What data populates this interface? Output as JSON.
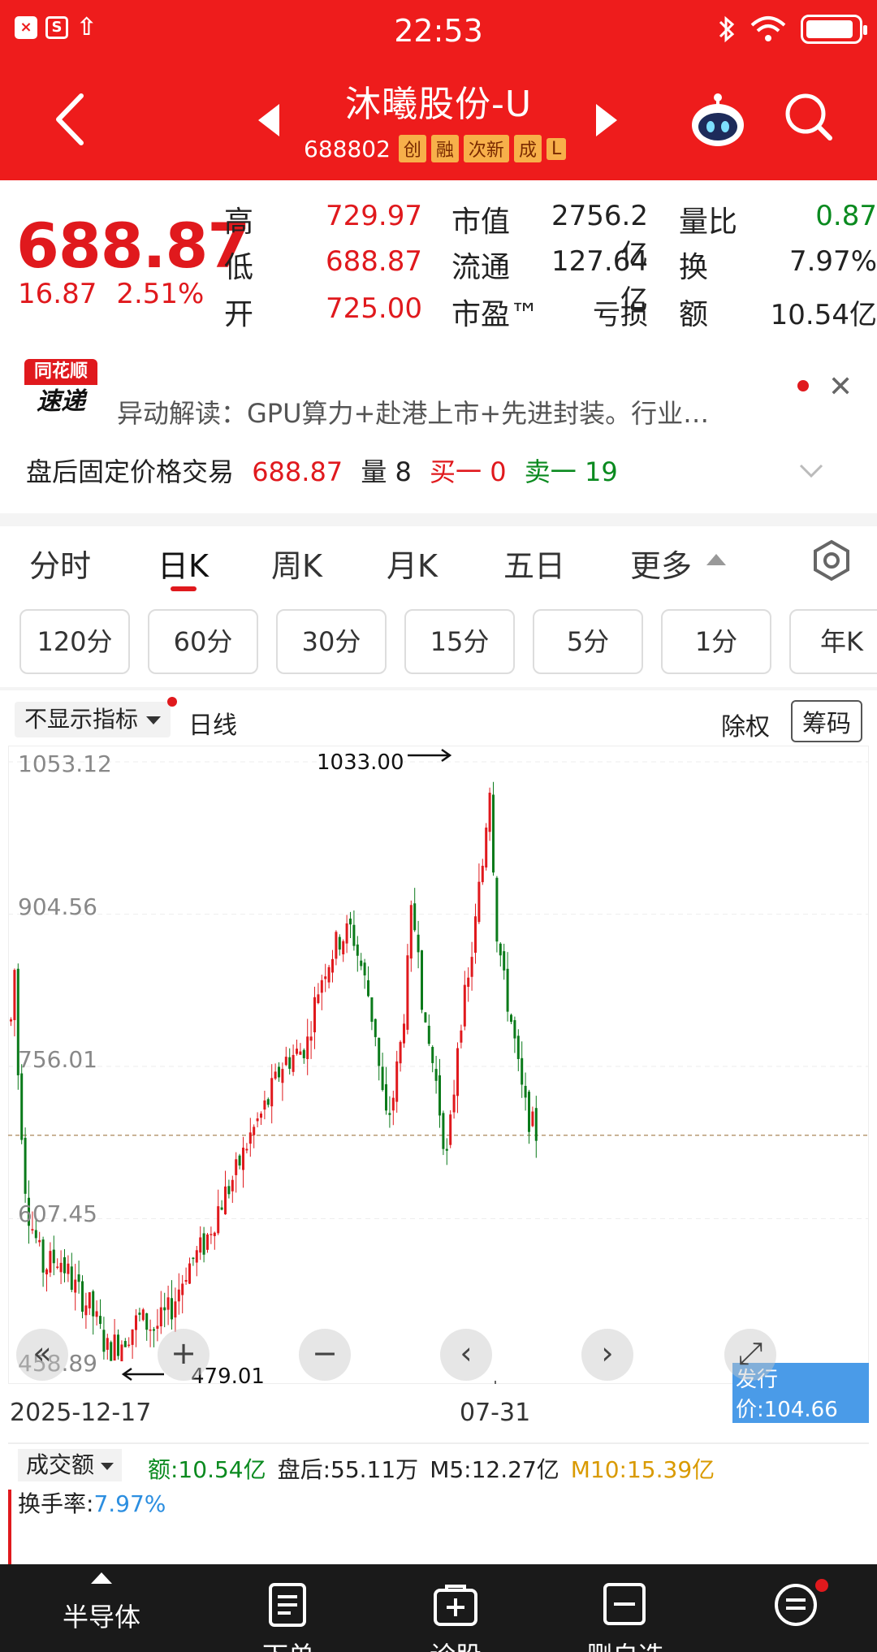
{
  "status_bar": {
    "time": "22:53"
  },
  "header": {
    "title": "沐曦股份-U",
    "code": "688802",
    "tags": [
      "创",
      "融",
      "次新",
      "成",
      "L"
    ]
  },
  "quote": {
    "price": "688.87",
    "change": "16.87",
    "change_pct": "2.51%",
    "fields": [
      {
        "label": "高",
        "value": "729.97",
        "color": "#e0191d"
      },
      {
        "label": "低",
        "value": "688.87",
        "color": "#e0191d"
      },
      {
        "label": "开",
        "value": "725.00",
        "color": "#e0191d"
      },
      {
        "label": "市值",
        "value": "2756.2亿",
        "color": "#222222"
      },
      {
        "label": "流通",
        "value": "127.64亿",
        "color": "#222222"
      },
      {
        "label": "市盈™",
        "value": "亏损",
        "color": "#222222"
      },
      {
        "label": "量比",
        "value": "0.87",
        "color": "#0a8a1f"
      },
      {
        "label": "换",
        "value": "7.97%",
        "color": "#222222"
      },
      {
        "label": "额",
        "value": "10.54亿",
        "color": "#222222"
      }
    ]
  },
  "news": {
    "brand_top": "同花顺",
    "brand_bottom": "速递",
    "text": "异动解读：GPU算力+赴港上市+先进封装。行业…"
  },
  "after_hours": {
    "label": "盘后固定价格交易",
    "price": "688.87",
    "vol_label": "量",
    "vol": "8",
    "buy_label": "买一",
    "buy": "0",
    "sell_label": "卖一",
    "sell": "19"
  },
  "tabs": [
    "分时",
    "日K",
    "周K",
    "月K",
    "五日",
    "更多"
  ],
  "periods": [
    "120分",
    "60分",
    "30分",
    "15分",
    "5分",
    "1分",
    "年K"
  ],
  "chart_header": {
    "indicator": "不显示指标",
    "line_type": "日线",
    "adjust": "除权",
    "chips": "筹码"
  },
  "chart_data": {
    "type": "candlestick",
    "y_tick_labels": [
      "1053.12",
      "904.56",
      "756.01",
      "607.45",
      "458.89"
    ],
    "high_marker": "1033.00",
    "low_marker": "479.01",
    "issue_price_label": "发行价:104.66",
    "x_labels": [
      "2025-12-17",
      "07-31"
    ],
    "last_close": 688.87,
    "up_color": "#e0191d",
    "down_color": "#0a7a1a"
  },
  "volume": {
    "selector": "成交额",
    "amount": "额:10.54亿",
    "after_hours": "盘后:55.11万",
    "m5": "M5:12.27亿",
    "m10": "M10:15.39亿",
    "turnover_label": "换手率:",
    "turnover": "7.97%"
  },
  "bottom_nav": [
    "半导体",
    "下单",
    "诊股",
    "删自选",
    ""
  ]
}
